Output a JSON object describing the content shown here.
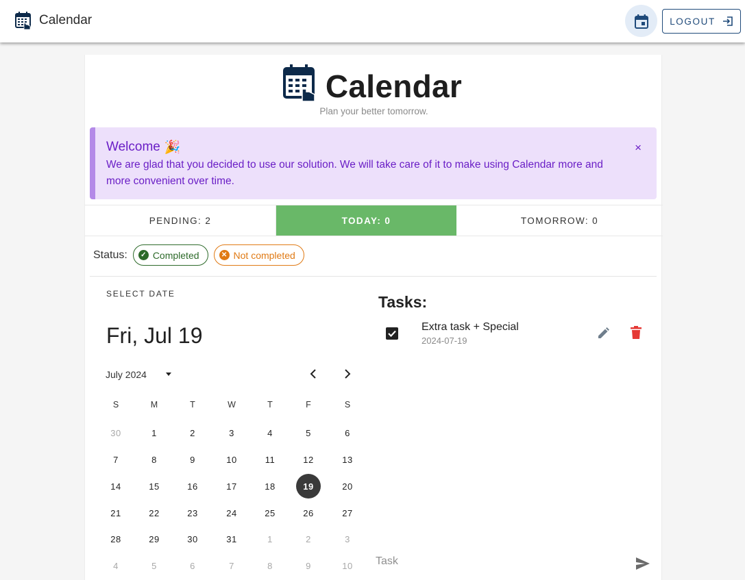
{
  "appbar": {
    "title": "Calendar",
    "logout_label": "LOGOUT"
  },
  "hero": {
    "title": "Calendar",
    "subtitle": "Plan your better tomorrow."
  },
  "alert": {
    "title": "Welcome",
    "emoji": "🎉",
    "text": "We are glad that you decided to use our solution. We will take care of it to make using Calendar more and more convenient over time.",
    "close": "×"
  },
  "tabs": [
    {
      "label": "PENDING: 2"
    },
    {
      "label": "TODAY: 0"
    },
    {
      "label": "TOMORROW: 0"
    }
  ],
  "status": {
    "label": "Status:",
    "completed": "Completed",
    "not_completed": "Not completed"
  },
  "picker": {
    "select_label": "SELECT DATE",
    "selected_date": "Fri, Jul 19",
    "month": "July 2024",
    "weekdays": [
      "S",
      "M",
      "T",
      "W",
      "T",
      "F",
      "S"
    ],
    "weeks": [
      [
        "30",
        "1",
        "2",
        "3",
        "4",
        "5",
        "6"
      ],
      [
        "7",
        "8",
        "9",
        "10",
        "11",
        "12",
        "13"
      ],
      [
        "14",
        "15",
        "16",
        "17",
        "18",
        "19",
        "20"
      ],
      [
        "21",
        "22",
        "23",
        "24",
        "25",
        "26",
        "27"
      ],
      [
        "28",
        "29",
        "30",
        "31",
        "1",
        "2",
        "3"
      ],
      [
        "4",
        "5",
        "6",
        "7",
        "8",
        "9",
        "10"
      ]
    ]
  },
  "tasks": {
    "title": "Tasks:",
    "items": [
      {
        "name": "Extra task + Special",
        "date": "2024-07-19",
        "checked": true
      }
    ],
    "input_placeholder": "Task"
  },
  "colors": {
    "primary": "#1f4a7a",
    "today_tab": "#69b868",
    "alert_bg": "#ede0fb",
    "alert_text": "#6a1ec6",
    "completed": "#2d6a2a",
    "not_completed": "#e07a14",
    "delete": "#e53935"
  }
}
